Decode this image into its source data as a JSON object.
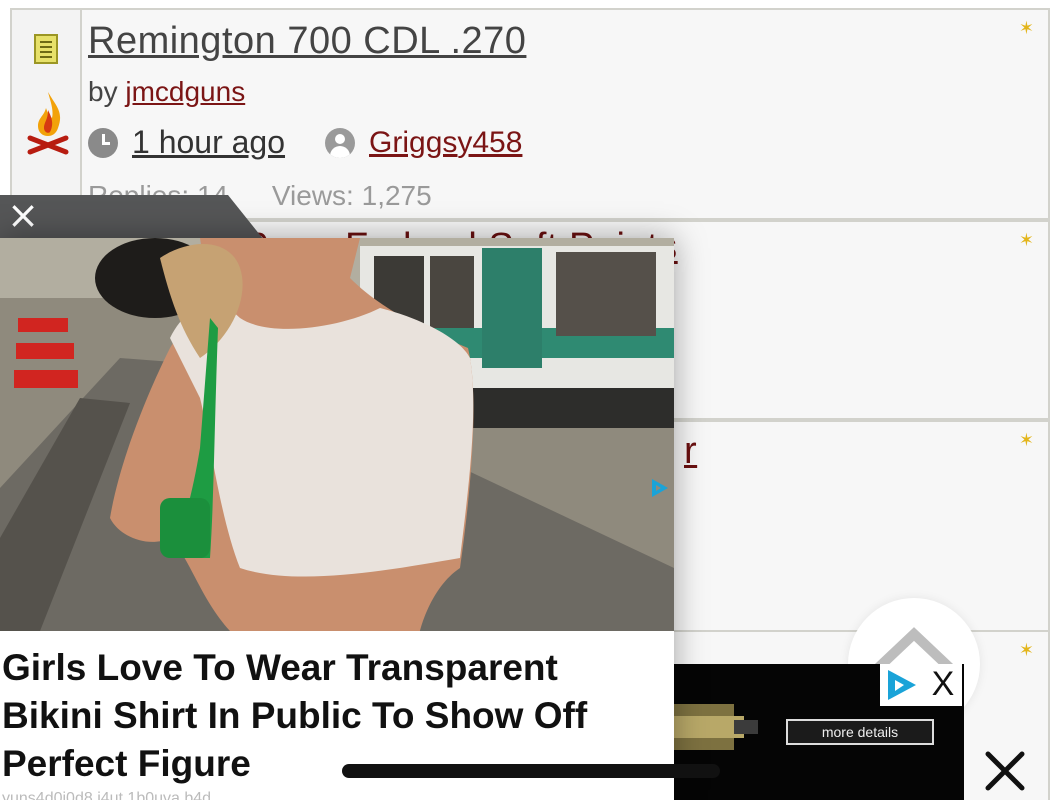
{
  "threads": [
    {
      "title": "Remington 700 CDL .270",
      "by_prefix": "by",
      "author": "jmcdguns",
      "time": "1 hour ago",
      "last_user": "Griggsy458",
      "replies": "Replies: 14",
      "views": "Views: 1,275"
    },
    {
      "title_fragment": "9mm Federal Soft Points"
    },
    {
      "title_fragment": "r"
    },
    {
      "title_fragment": ""
    }
  ],
  "overlay_ad": {
    "close_glyph": "×",
    "headline": "Girls Love To Wear Transparent Bikini Shirt In Public To Show Off Perfect Figure",
    "sub_text": "yuns4d0i0d8 i4ut 1b0uva b4d"
  },
  "banner_ad": {
    "button_label": "more details",
    "close_label": "X"
  },
  "colors": {
    "link_red": "#7b1515",
    "row_border": "#d2d2cc",
    "adchoices_blue": "#1aa3d8"
  },
  "icons": [
    "document-icon",
    "campfire-icon",
    "clock-icon",
    "user-icon",
    "star-icon",
    "close-icon",
    "adchoices-icon",
    "scroll-up-icon"
  ]
}
